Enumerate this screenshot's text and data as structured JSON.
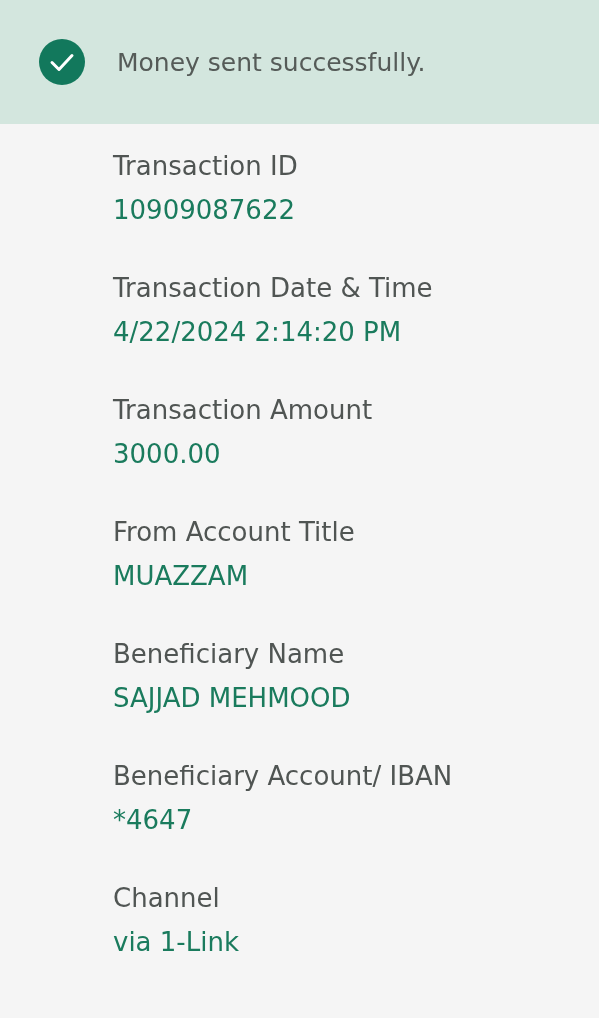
{
  "banner": {
    "message": "Money sent successfully."
  },
  "details": [
    {
      "label": "Transaction ID",
      "value": "10909087622"
    },
    {
      "label": "Transaction Date & Time",
      "value": "4/22/2024 2:14:20 PM"
    },
    {
      "label": "Transaction Amount",
      "value": "3000.00"
    },
    {
      "label": "From Account Title",
      "value": "MUAZZAM"
    },
    {
      "label": "Beneficiary Name",
      "value": "SAJJAD MEHMOOD"
    },
    {
      "label": "Beneficiary Account/ IBAN",
      "value": "*4647"
    },
    {
      "label": "Channel",
      "value": "via 1-Link"
    }
  ]
}
